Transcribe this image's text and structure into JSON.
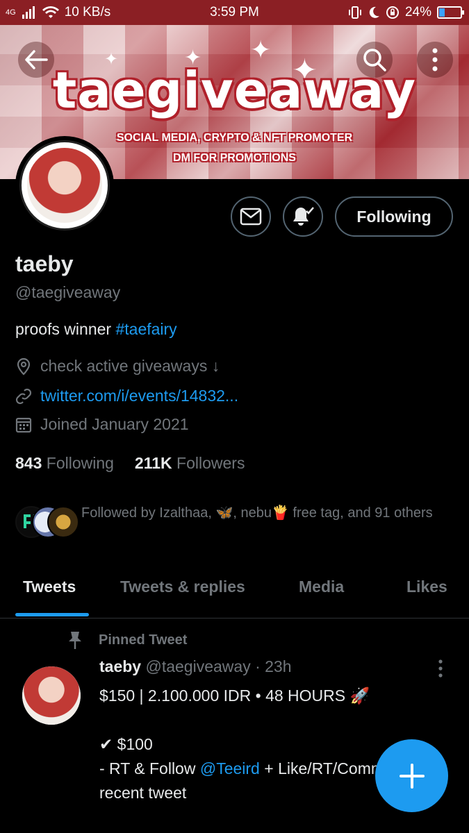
{
  "status_bar": {
    "network": "4G",
    "speed": "10 KB/s",
    "time": "3:59 PM",
    "battery": "24%",
    "battery_level": 0.24
  },
  "banner": {
    "title": "taegiveaway",
    "subtitle_1": "SOCIAL MEDIA, CRYPTO & NFT PROMOTER",
    "subtitle_2": "DM FOR PROMOTIONS"
  },
  "profile": {
    "name": "taeby",
    "handle": "@taegiveaway",
    "bio_text": "proofs winner",
    "bio_hashtag": "#taefairy",
    "location": "check active giveaways ↓",
    "website": "twitter.com/i/events/14832...",
    "joined": "Joined January 2021",
    "following_count": "843",
    "following_label": "Following",
    "followers_count": "211K",
    "followers_label": "Followers",
    "followed_by": "Followed by Izalthaa, 🦋, nebu🍟 free tag, and 91 others"
  },
  "actions": {
    "following_button": "Following"
  },
  "tabs": [
    {
      "label": "Tweets",
      "active": true
    },
    {
      "label": "Tweets & replies",
      "active": false
    },
    {
      "label": "Media",
      "active": false
    },
    {
      "label": "Likes",
      "active": false
    }
  ],
  "pinned_tweet": {
    "pinned_label": "Pinned Tweet",
    "author_name": "taeby",
    "author_handle": "@taegiveaway",
    "time": "· 23h",
    "line1": "$150 | 2.100.000 IDR • 48 HOURS 🚀",
    "line2": "✔ $100",
    "line3_prefix": "- RT & Follow",
    "line3_mention": "@Teeird",
    "line3_suffix": "+ Like/RT/Comment",
    "line4": "recent tweet"
  },
  "colors": {
    "accent": "#1d9bf0",
    "status_bar": "#8b1f24",
    "background": "#000000",
    "secondary_text": "#71767b"
  }
}
